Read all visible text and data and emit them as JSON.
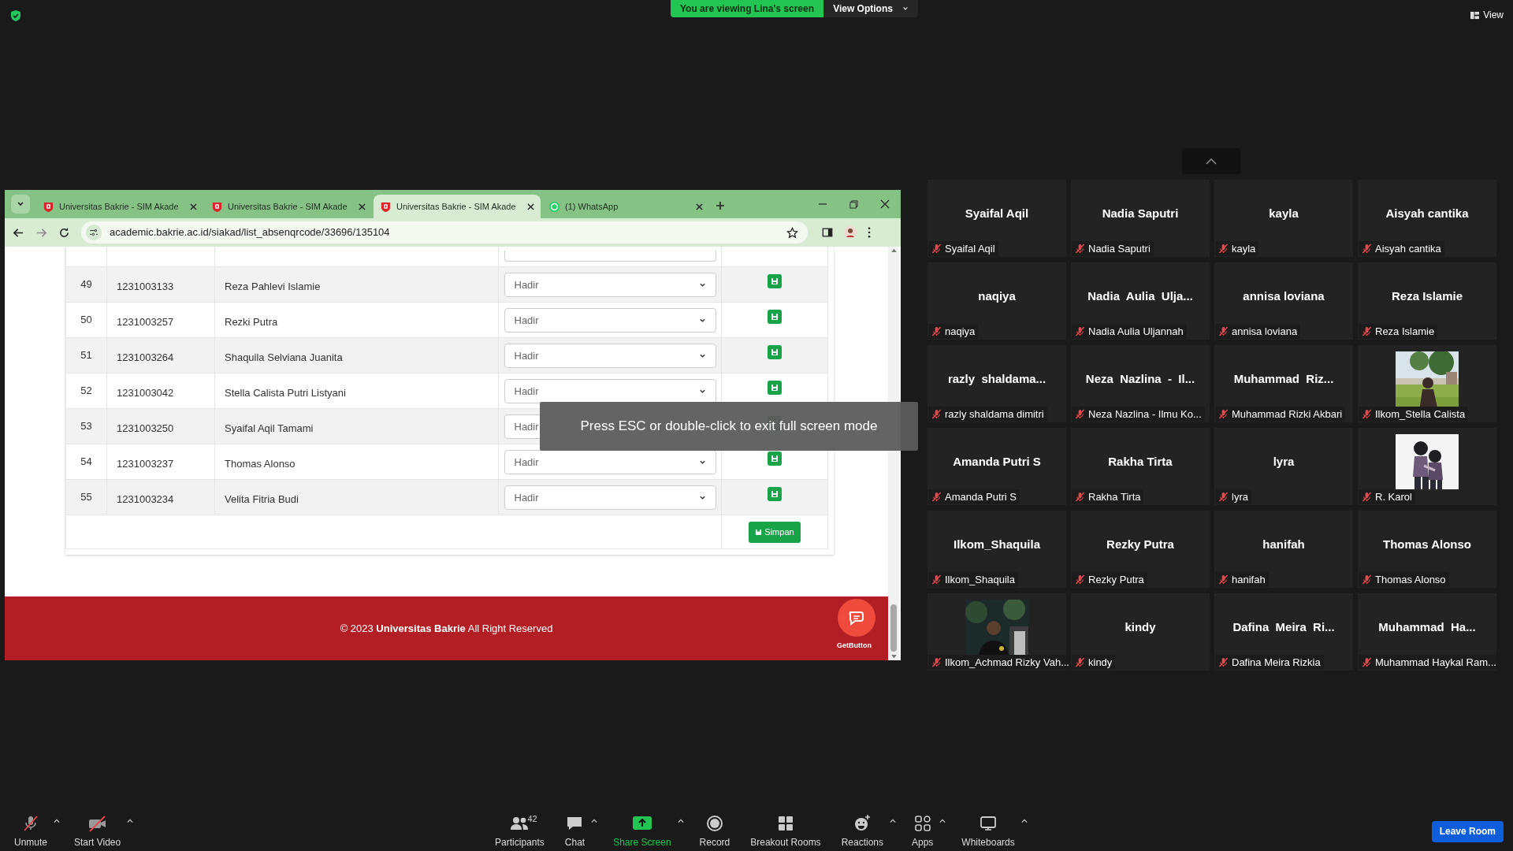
{
  "meeting_banner": {
    "text": "You are viewing Lina's screen",
    "view_options": "View Options"
  },
  "view_button": "View",
  "browser": {
    "tabs": [
      {
        "title": "Universitas Bakrie - SIM Akade",
        "kind": "site",
        "selected": false
      },
      {
        "title": "Universitas Bakrie - SIM Akade",
        "kind": "site",
        "selected": false
      },
      {
        "title": "Universitas Bakrie - SIM Akade",
        "kind": "site",
        "selected": true
      },
      {
        "title": "(1) WhatsApp",
        "kind": "whatsapp",
        "selected": false
      }
    ],
    "url": "academic.bakrie.ac.id/siakad/list_absenqrcode/33696/135104"
  },
  "attendance_table": {
    "rows": [
      {
        "no": "49",
        "nim": "1231003133",
        "name": "Reza Pahlevi Islamie",
        "status": "Hadir"
      },
      {
        "no": "50",
        "nim": "1231003257",
        "name": "Rezki Putra",
        "status": "Hadir"
      },
      {
        "no": "51",
        "nim": "1231003264",
        "name": "Shaquila Selviana Juanita",
        "status": "Hadir"
      },
      {
        "no": "52",
        "nim": "1231003042",
        "name": "Stella Calista Putri Listyani",
        "status": "Hadir"
      },
      {
        "no": "53",
        "nim": "1231003250",
        "name": "Syaifal Aqil Tamami",
        "status": "Hadir"
      },
      {
        "no": "54",
        "nim": "1231003237",
        "name": "Thomas Alonso",
        "status": "Hadir"
      },
      {
        "no": "55",
        "nim": "1231003234",
        "name": "Velita Fitria Budi",
        "status": "Hadir"
      }
    ],
    "save_all": "Simpan"
  },
  "footer": {
    "text": "© 2023 **Universitas Bakrie** All Right Reserved",
    "chat_widget": "GetButton"
  },
  "fullscreen_toast": "Press ESC or double-click to exit full screen mode",
  "participants": [
    {
      "display": "Syaifal Aqil",
      "label": "Syaifal Aqil",
      "muted": true,
      "kind": "name"
    },
    {
      "display": "Nadia Saputri",
      "label": "Nadia Saputri",
      "muted": true,
      "kind": "name"
    },
    {
      "display": "kayla",
      "label": "kayla",
      "muted": true,
      "kind": "name"
    },
    {
      "display": "Aisyah cantika",
      "label": "Aisyah cantika",
      "muted": true,
      "kind": "name"
    },
    {
      "display": "naqiya",
      "label": "naqiya",
      "muted": true,
      "kind": "name"
    },
    {
      "display": "Nadia  Aulia  Ulja...",
      "label": "Nadia Aulia Uljannah",
      "muted": true,
      "kind": "name"
    },
    {
      "display": "annisa loviana",
      "label": "annisa loviana",
      "muted": true,
      "kind": "name"
    },
    {
      "display": "Reza Islamie",
      "label": "Reza Islamie",
      "muted": true,
      "kind": "name"
    },
    {
      "display": "razly  shaldama...",
      "label": "razly shaldama dimitri",
      "muted": true,
      "kind": "name"
    },
    {
      "display": "Neza  Nazlina  -  Il...",
      "label": "Neza Nazlina - Ilmu Ko...",
      "muted": true,
      "kind": "name"
    },
    {
      "display": "Muhammad  Riz...",
      "label": "Muhammad Rizki Akbari",
      "muted": true,
      "kind": "name"
    },
    {
      "label": "Ilkom_Stella Calista",
      "muted": true,
      "kind": "picture"
    },
    {
      "display": "Amanda Putri S",
      "label": "Amanda Putri S",
      "muted": true,
      "kind": "name"
    },
    {
      "display": "Rakha Tirta",
      "label": "Rakha Tirta",
      "muted": true,
      "kind": "name"
    },
    {
      "display": "lyra",
      "label": "lyra",
      "muted": true,
      "kind": "name"
    },
    {
      "label": "R. Karol",
      "muted": true,
      "kind": "picture"
    },
    {
      "display": "Ilkom_Shaquila",
      "label": "Ilkom_Shaquila",
      "muted": true,
      "kind": "name"
    },
    {
      "display": "Rezky Putra",
      "label": "Rezky Putra",
      "muted": true,
      "kind": "name"
    },
    {
      "display": "hanifah",
      "label": "hanifah",
      "muted": true,
      "kind": "name"
    },
    {
      "display": "Thomas Alonso",
      "label": "Thomas Alonso",
      "muted": true,
      "kind": "name"
    },
    {
      "label": "Ilkom_Achmad Rizky Vah...",
      "muted": true,
      "kind": "picture"
    },
    {
      "display": "kindy",
      "label": "kindy",
      "muted": true,
      "kind": "name"
    },
    {
      "display": "Dafina  Meira  Ri...",
      "label": "Dafina Meira Rizkia",
      "muted": true,
      "kind": "name"
    },
    {
      "display": "Muhammad  Ha...",
      "label": "Muhammad Haykal Ram...",
      "muted": true,
      "kind": "name"
    }
  ],
  "toolbar": {
    "left": [
      {
        "label": "Unmute",
        "kind": "mic",
        "caret": true
      },
      {
        "label": "Start Video",
        "kind": "video",
        "caret": true
      }
    ],
    "center": [
      {
        "label": "Participants",
        "kind": "participants",
        "count": "42",
        "caret": false
      },
      {
        "label": "Chat",
        "kind": "chat",
        "caret": true
      },
      {
        "label": "Share Screen",
        "kind": "share",
        "caret": true
      },
      {
        "label": "Record",
        "kind": "record",
        "caret": false
      },
      {
        "label": "Breakout Rooms",
        "kind": "breakout",
        "caret": false
      },
      {
        "label": "Reactions",
        "kind": "reactions",
        "caret": true
      },
      {
        "label": "Apps",
        "kind": "apps",
        "caret": true
      },
      {
        "label": "Whiteboards",
        "kind": "whiteboards",
        "caret": true
      }
    ],
    "leave": "Leave Room"
  }
}
